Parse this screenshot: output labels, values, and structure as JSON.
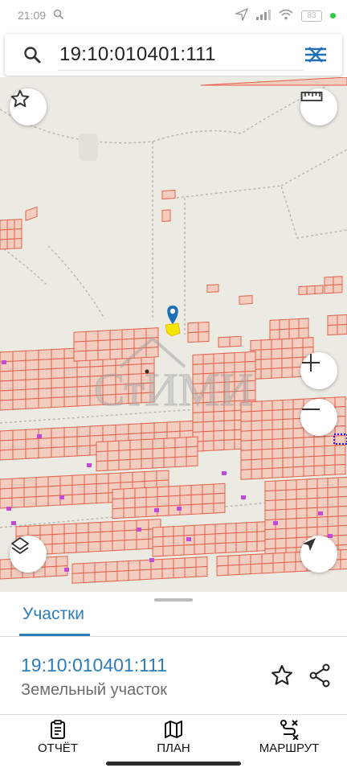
{
  "status_bar": {
    "time": "21:09",
    "battery": "83"
  },
  "search": {
    "value": "19:10:010401:111"
  },
  "map": {
    "watermark": "СтИМИ",
    "colors": {
      "background": "#ecebe3",
      "parcel_stroke": "#e5604a",
      "parcel_fill": "#f3cdbf",
      "marker": "#1f6fb5",
      "highlight": "#f4e600"
    }
  },
  "sheet": {
    "tab_label": "Участки",
    "parcel": {
      "id": "19:10:010401:111",
      "type": "Земельный участок"
    }
  },
  "bottom_nav": {
    "report": "ОТЧЁТ",
    "plan": "ПЛАН",
    "route": "МАРШРУТ"
  },
  "icons": {
    "search": "search-icon",
    "filter": "filter-icon",
    "star": "star-icon",
    "ruler": "ruler-icon",
    "zoom_in": "plus-icon",
    "zoom_out": "minus-icon",
    "layers": "layers-icon",
    "locate": "navigation-arrow-icon",
    "share": "share-icon",
    "report": "clipboard-icon",
    "plan": "map-icon",
    "route": "route-icon"
  }
}
